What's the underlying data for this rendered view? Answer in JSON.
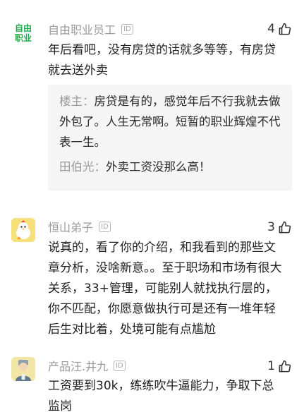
{
  "comments": [
    {
      "avatar_text": [
        "自由",
        "职业"
      ],
      "name": "自由职业员工",
      "id_badge": "ID",
      "likes": "4",
      "text": "年后看吧，没有房贷的话就多等等，有房贷就去送外卖",
      "replies": [
        {
          "name": "楼主：",
          "text": "房贷是有的，感觉年后不行我就去做外包了。人生无常啊。短暂的职业辉煌不代表一生。"
        },
        {
          "name": "田伯光：",
          "text": "外卖工资没那么高！"
        }
      ]
    },
    {
      "name": "恒山弟子",
      "id_badge": "ID",
      "likes": "3",
      "text": "说真的，看了你的介绍，和我看到的那些文章分析，没啥新意。。至于职场和市场有很大关系，33+管理，可能别人就找执行层的，你不匹配，你愿意做执行可是还有一堆年轻后生对比着，处境可能有点尴尬"
    },
    {
      "name": "产品汪.井九",
      "id_badge": "ID",
      "likes": "1",
      "text": "工资要到30k，练练吹牛逼能力，争取下总监岗"
    }
  ],
  "colors": {
    "logo_green": "#1faa4b",
    "name_gray": "#9a9a9a",
    "reply_bg": "#f5f5f5"
  }
}
